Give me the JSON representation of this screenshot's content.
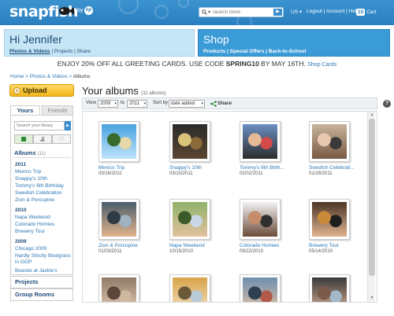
{
  "brand": {
    "logo_text": "snapfish",
    "by_label": "by",
    "hp_label": "hp"
  },
  "search": {
    "placeholder": "Search Store",
    "go_glyph": "▶"
  },
  "header": {
    "locale": "US ▾",
    "links": [
      "Logout",
      "Account",
      "Help"
    ],
    "cart_count": "10",
    "cart_label": "Cart"
  },
  "greeting": {
    "title": "Hi Jennifer",
    "links": [
      "Photos & Videos",
      "Projects",
      "Share"
    ]
  },
  "shop": {
    "title": "Shop",
    "links": [
      "Products",
      "Special Offers",
      "Back-to-School"
    ]
  },
  "promo": {
    "text_1": "ENJOY 20% OFF ALL GREETING CARDS. USE CODE ",
    "code": "SPRING10",
    "text_2": " BY MAY 16TH.",
    "link": "Shop Cards"
  },
  "breadcrumb": {
    "home": "Home",
    "section": "Photos & Videos",
    "current": "Albums"
  },
  "upload": {
    "label": "Upload",
    "icon_glyph": "+"
  },
  "sidebar": {
    "tab_yours": "Yours",
    "tab_friends": "Friends",
    "search_placeholder": "Search your library",
    "albums_title": "Albums",
    "albums_count": "(11)",
    "groups": [
      {
        "year": "2011",
        "items": [
          "Mexico Trip",
          "Snappy's 10th",
          "Tommy's 6th Birthday",
          "Swedish Celebration",
          "Zion & Porcupine"
        ]
      },
      {
        "year": "2010",
        "items": [
          "Napa Weekend",
          "Colorado Homies",
          "Brewery Tour"
        ]
      },
      {
        "year": "2009",
        "items": [
          "Chicago 2009",
          "Hardly Strictly Bluegrass in GGP",
          "Beastie at Jackie's"
        ]
      }
    ],
    "projects": "Projects",
    "group_rooms": "Group Rooms"
  },
  "main": {
    "title": "Your albums",
    "count": "(11 albums)",
    "toolbar": {
      "view_label": "View",
      "from_year": "2009",
      "to_label": "to",
      "to_year": "2011",
      "sort_label": "Sort by",
      "sort_value": "date added",
      "share_label": "Share",
      "help_glyph": "?"
    },
    "albums": [
      {
        "title": "Mexico Trip",
        "date": "03/16/2011",
        "palette": [
          "#4aa3e0",
          "#bfe3fa",
          "#3a6b2e",
          "#e6d8a8"
        ]
      },
      {
        "title": "Snappy's 10th",
        "date": "03/10/2011",
        "palette": [
          "#2b2b2b",
          "#5a4630",
          "#d8c27a",
          "#8c6a3a"
        ]
      },
      {
        "title": "Tommy's 6th Birth...",
        "date": "02/02/2011",
        "palette": [
          "#6a8fc2",
          "#2c2c2c",
          "#e4b996",
          "#d34a4a"
        ]
      },
      {
        "title": "Swedish Celebrati...",
        "date": "01/28/2011",
        "palette": [
          "#c7b49a",
          "#7a5a45",
          "#e8c8b0",
          "#3a3a3a"
        ]
      },
      {
        "title": "Zion & Porcupine",
        "date": "01/03/2011",
        "palette": [
          "#4a5d6b",
          "#e2b48c",
          "#2f3b44",
          "#9fb2c1"
        ]
      },
      {
        "title": "Napa Weekend",
        "date": "10/15/2010",
        "palette": [
          "#8fb36a",
          "#e3c19d",
          "#3d5a2a",
          "#c9d8e8"
        ]
      },
      {
        "title": "Colorado Homies",
        "date": "09/22/2010",
        "palette": [
          "#f2f2f2",
          "#6b4c3a",
          "#c48c6a",
          "#2f2f2f"
        ]
      },
      {
        "title": "Brewery Tour",
        "date": "05/14/2010",
        "palette": [
          "#4a3526",
          "#e1b38f",
          "#c98a3a",
          "#1f1f1f"
        ]
      },
      {
        "title": "",
        "date": "",
        "palette": [
          "#8f7a68",
          "#e8cdb5",
          "#5a463a",
          "#cfb8a0"
        ]
      },
      {
        "title": "",
        "date": "",
        "palette": [
          "#d9a44a",
          "#f3e0c4",
          "#6b5a3a",
          "#b8c9d8"
        ]
      },
      {
        "title": "",
        "date": "",
        "palette": [
          "#6f8fb0",
          "#e6c3a3",
          "#2e3f52",
          "#b25a4a"
        ]
      },
      {
        "title": "",
        "date": "",
        "palette": [
          "#3a3a3a",
          "#d8b096",
          "#7a5a4a",
          "#a3b8c8"
        ]
      }
    ]
  }
}
